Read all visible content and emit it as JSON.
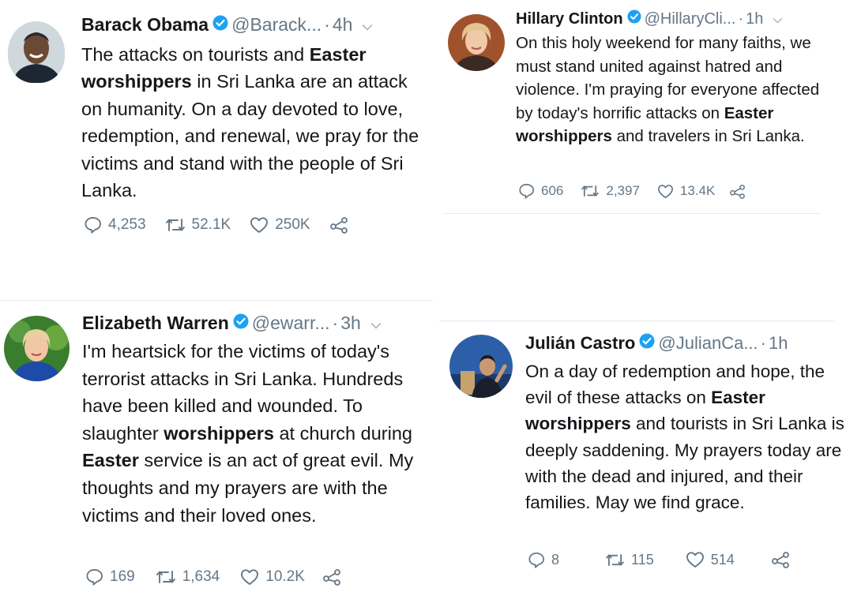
{
  "tweets": {
    "obama": {
      "name": "Barack Obama",
      "handle": "@Barack...",
      "time": "4h",
      "text": [
        {
          "t": "The attacks on tourists and "
        },
        {
          "t": "Easter",
          "b": true
        },
        {
          "t": " "
        },
        {
          "t": "worshippers",
          "b": true
        },
        {
          "t": " in Sri Lanka are an attack on humanity. On a day devoted to love, redemption, and renewal, we pray for the victims and stand with the people of Sri Lanka."
        }
      ],
      "replies": "4,253",
      "retweets": "52.1K",
      "likes": "250K"
    },
    "clinton": {
      "name": "Hillary Clinton",
      "handle": "@HillaryCli...",
      "time": "1h",
      "text": [
        {
          "t": "On this holy weekend for many faiths, we must stand united against hatred and violence. I'm praying for everyone affected by today's horrific attacks on "
        },
        {
          "t": "Easter worshippers",
          "b": true
        },
        {
          "t": " and travelers in Sri Lanka."
        }
      ],
      "replies": "606",
      "retweets": "2,397",
      "likes": "13.4K"
    },
    "warren": {
      "name": "Elizabeth Warren",
      "handle": "@ewarr...",
      "time": "3h",
      "text": [
        {
          "t": "I'm heartsick for the victims of today's terrorist attacks in Sri Lanka. Hundreds have been killed and wounded. To slaughter "
        },
        {
          "t": "worshippers",
          "b": true
        },
        {
          "t": " at church during "
        },
        {
          "t": "Easter",
          "b": true
        },
        {
          "t": " service is an act of great evil. My thoughts and my prayers are with the victims and their loved ones."
        }
      ],
      "replies": "169",
      "retweets": "1,634",
      "likes": "10.2K"
    },
    "castro": {
      "name": "Julián Castro",
      "handle": "@JulianCa...",
      "time": "1h",
      "text": [
        {
          "t": "On a day of redemption and hope, the evil of these attacks on "
        },
        {
          "t": "Easter",
          "b": true
        },
        {
          "t": " "
        },
        {
          "t": "worshippers",
          "b": true
        },
        {
          "t": " and tourists in Sri Lanka is deeply saddening. My prayers today are with the dead and injured, and their families. May we find grace."
        }
      ],
      "replies": "8",
      "retweets": "115",
      "likes": "514"
    }
  },
  "icons": {
    "verified": "verified-badge-icon",
    "menu": "chevron-down-icon",
    "reply": "reply-icon",
    "retweet": "retweet-icon",
    "like": "heart-icon",
    "share": "share-icon"
  },
  "colors": {
    "text": "#14171a",
    "muted": "#657786",
    "verified": "#1da1f2",
    "divider": "#e6ecf0"
  }
}
